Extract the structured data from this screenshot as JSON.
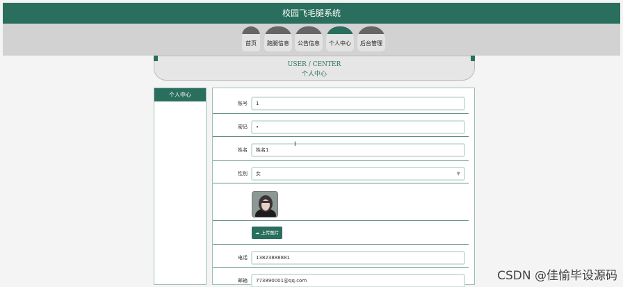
{
  "header": {
    "title": "校园飞毛腿系统"
  },
  "nav": {
    "items": [
      {
        "label": "首页"
      },
      {
        "label": "跑腿信息"
      },
      {
        "label": "公告信息"
      },
      {
        "label": "个人中心"
      },
      {
        "label": "后台管理"
      }
    ],
    "active": "个人中心"
  },
  "center_banner": {
    "en": "USER / CENTER",
    "cn": "个人中心"
  },
  "sidebar": {
    "header": "个人中心"
  },
  "form": {
    "account": {
      "label": "账号",
      "value": "1"
    },
    "password": {
      "label": "密码",
      "value": "•"
    },
    "name": {
      "label": "姓名",
      "value": "姓名1"
    },
    "gender": {
      "label": "性别",
      "value": "女"
    },
    "upload_label": "上传图片",
    "phone": {
      "label": "电话",
      "value": "13823888881"
    },
    "email": {
      "label": "邮箱",
      "value": "773890001@qq.com"
    }
  },
  "watermark": "CSDN @佳愉毕设源码",
  "colors": {
    "brand": "#2a6f5e",
    "nav_band": "#d2d2d2"
  },
  "icons": {
    "upload": "cloud-upload-icon",
    "select": "chevron-down-icon"
  }
}
